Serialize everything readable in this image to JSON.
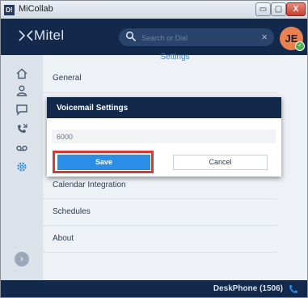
{
  "window": {
    "app_icon_text": "D!",
    "title": "MiCollab",
    "minimize_label": "▭",
    "maximize_label": "▢",
    "close_label": "X"
  },
  "header": {
    "logo_text": "Mitel",
    "search": {
      "placeholder": "Search or Dial",
      "clear_label": "×"
    },
    "avatar": {
      "initials": "JE",
      "presence": "✓"
    }
  },
  "sidebar": {
    "icons": [
      "home-icon",
      "contacts-icon",
      "chat-icon",
      "call-history-icon",
      "voicemail-icon",
      "settings-icon"
    ],
    "expand_label": "›"
  },
  "settings": {
    "title": "Settings",
    "menu": [
      {
        "label": "General"
      },
      {
        "label": "Calendar Integration"
      },
      {
        "label": "Schedules"
      },
      {
        "label": "About"
      }
    ]
  },
  "dialog": {
    "title": "Voicemail Settings",
    "input_value": "6000",
    "save_label": "Save",
    "cancel_label": "Cancel"
  },
  "footer": {
    "device_label": "DeskPhone (1506)"
  },
  "colors": {
    "navy": "#13294b",
    "accent_blue": "#2b8ee6",
    "highlight_red": "#d93a36",
    "settings_blue": "#3c7ec4"
  }
}
